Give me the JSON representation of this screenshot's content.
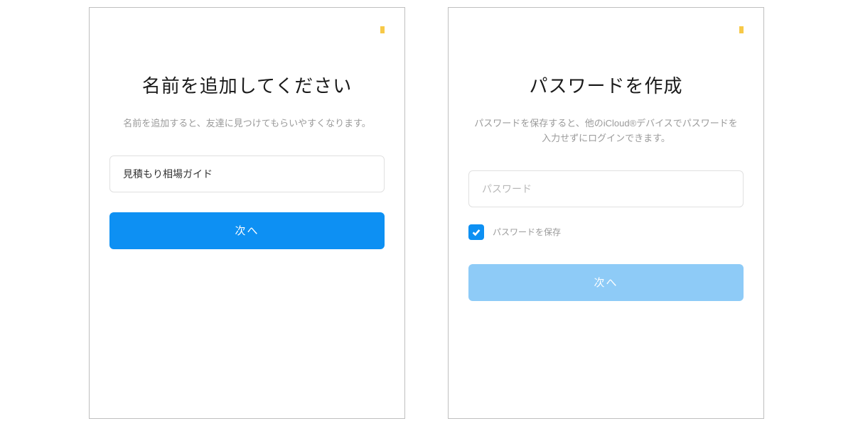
{
  "left": {
    "title": "名前を追加してください",
    "subtitle": "名前を追加すると、友達に見つけてもらいやすくなります。",
    "name_input_value": "見積もり相場ガイド",
    "next_label": "次へ"
  },
  "right": {
    "title": "パスワードを作成",
    "subtitle": "パスワードを保存すると、他のiCloud®デバイスでパスワードを入力せずにログインできます。",
    "password_placeholder": "パスワード",
    "save_password_label": "パスワードを保存",
    "save_password_checked": true,
    "next_label": "次へ"
  }
}
